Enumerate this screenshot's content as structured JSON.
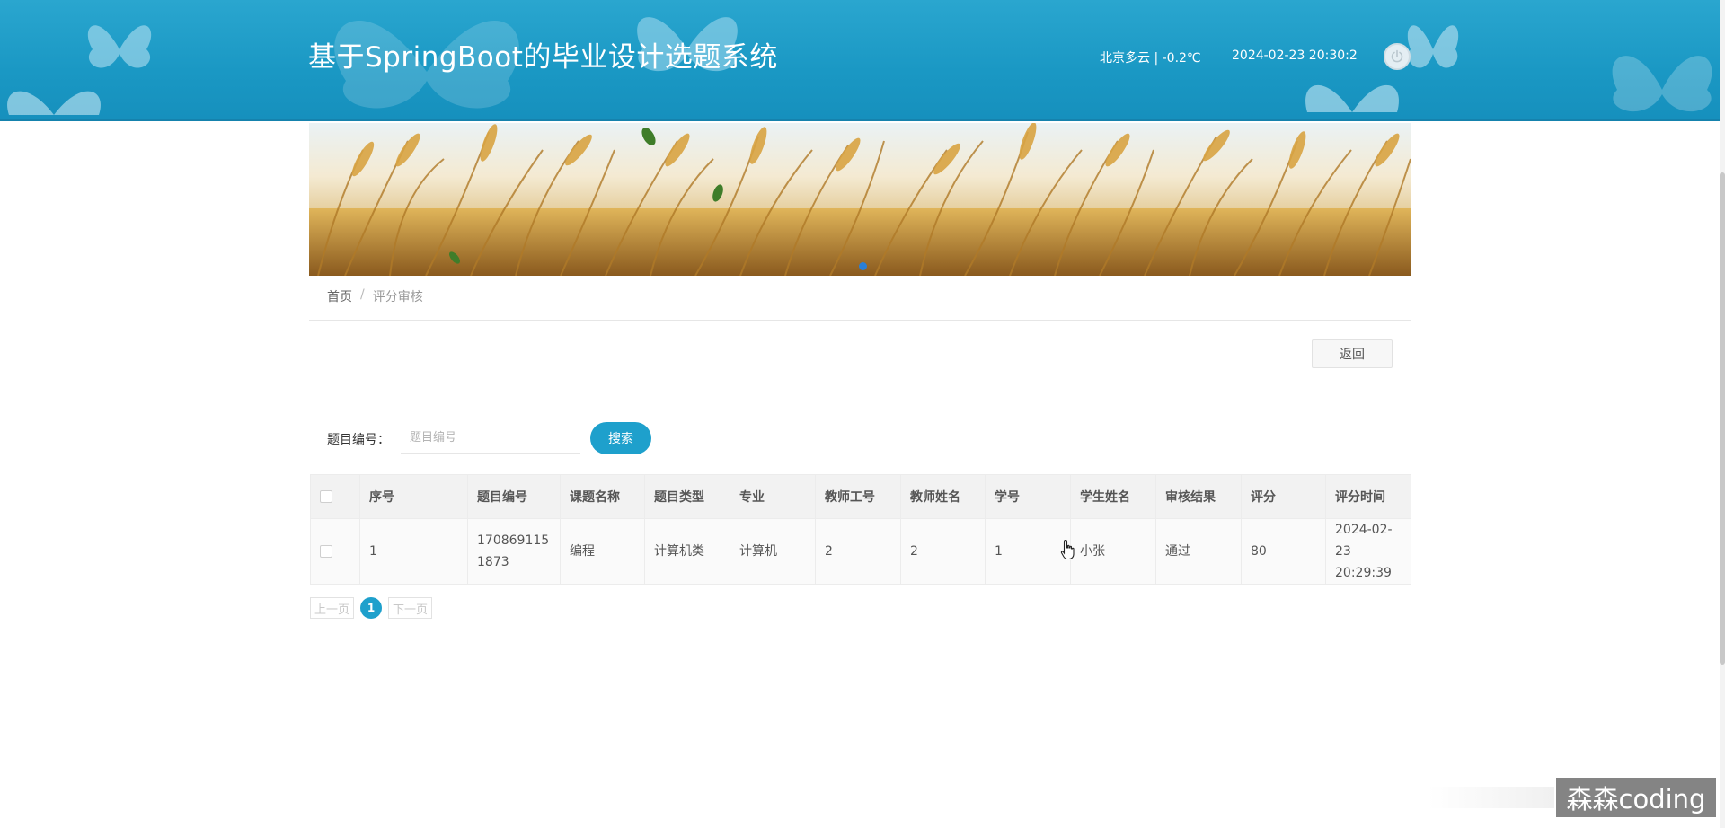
{
  "header": {
    "title": "基于SpringBoot的毕业设计选题系统",
    "weather": "北京多云 | -0.2℃",
    "datetime": "2024-02-23  20:30:2",
    "power_icon": "power-icon",
    "bg_color": "#1a98c4"
  },
  "breadcrumb": {
    "home": "首页",
    "separator": "/",
    "current": "评分审核"
  },
  "actions": {
    "back_label": "返回"
  },
  "search": {
    "label": "题目编号：",
    "placeholder": "题目编号",
    "value": "",
    "button_label": "搜索"
  },
  "table": {
    "headers": [
      "序号",
      "题目编号",
      "课题名称",
      "题目类型",
      "专业",
      "教师工号",
      "教师姓名",
      "学号",
      "学生姓名",
      "审核结果",
      "评分",
      "评分时间"
    ],
    "rows": [
      [
        "1",
        "1708691151873",
        "编程",
        "计算机类",
        "计算机",
        "2",
        "2",
        "1",
        "小张",
        "通过",
        "80",
        "2024-02-23 20:29:39"
      ]
    ]
  },
  "pagination": {
    "prev": "上一页",
    "current": "1",
    "next": "下一页"
  },
  "watermark": "森森coding",
  "colors": {
    "accent": "#1ea0cc",
    "banner_dot": "#2a7fd6"
  }
}
